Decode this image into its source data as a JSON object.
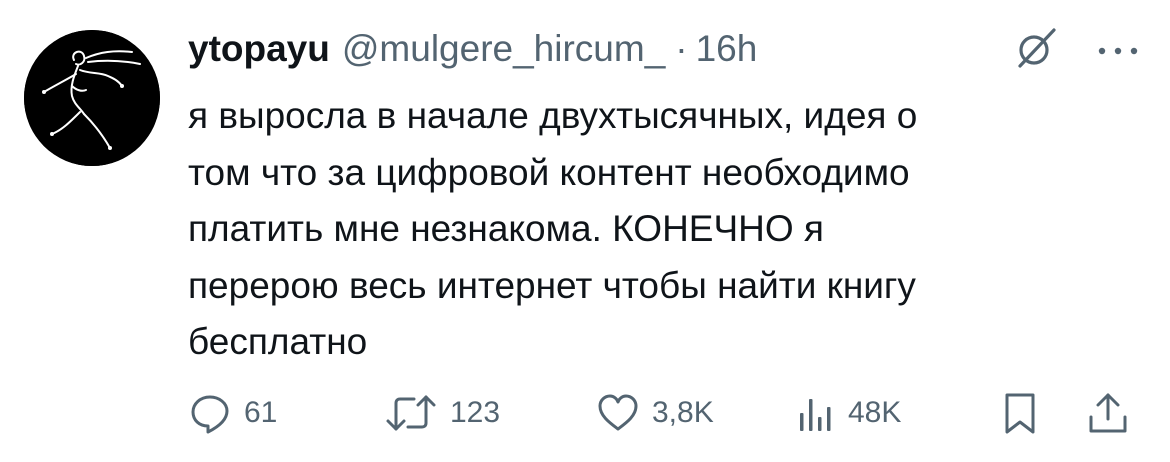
{
  "tweet": {
    "author": {
      "display_name": "ytopayu",
      "handle": "@mulgere_hircum_",
      "separator": "·",
      "time": "16h"
    },
    "text": "я выросла в начале двухтысячных, идея о\nтом что за цифровой контент необходимо\nплатить мне незнакома. КОНЕЧНО я\nперерою весь интернет чтобы найти книгу\nбесплатно",
    "stats": {
      "replies": "61",
      "reposts": "123",
      "likes": "3,8K",
      "views": "48K"
    },
    "icons": {
      "top_right": [
        "grok-icon",
        "more-icon"
      ],
      "actions": [
        "reply-icon",
        "retweet-icon",
        "like-icon",
        "views-icon",
        "bookmark-icon",
        "share-icon"
      ]
    },
    "colors": {
      "text": "#0f1419",
      "secondary": "#536471",
      "avatar_bg": "#000000"
    }
  }
}
